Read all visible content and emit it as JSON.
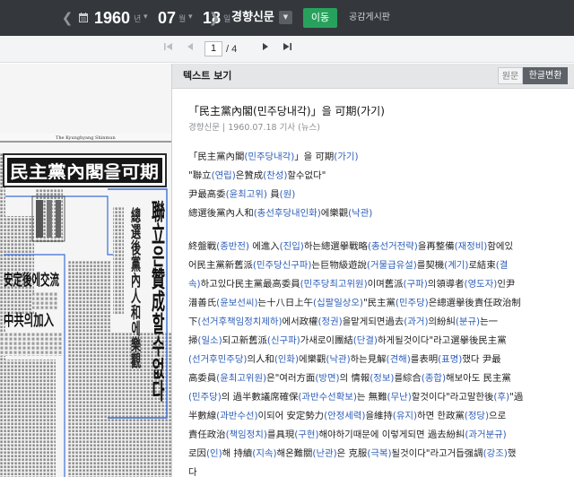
{
  "toolbar": {
    "year": "1960",
    "year_unit": "년",
    "month": "07",
    "month_unit": "월",
    "day": "18",
    "day_unit": "일",
    "newspaper": "경향신문",
    "go_label": "이동",
    "share_label": "공감게시판"
  },
  "pager": {
    "current_page": "1",
    "total": "/ 4"
  },
  "scan": {
    "masthead": "The Kyunghyang Shinmun",
    "headline_box": "民主黨內閣을可期",
    "headline_vertical_1": "聯立은贊成할수없다",
    "headline_vertical_2": "總選後黨內人和에樂觀",
    "left_headline_1": "安定後에交流",
    "left_headline_2": "中共의加入"
  },
  "panel": {
    "title": "텍스트 보기",
    "tab_original": "원문",
    "tab_converted": "한글변환"
  },
  "article": {
    "title": [
      {
        "t": "「民主黨內閣"
      },
      {
        "t": "(민주당내각)",
        "h": true
      },
      {
        "t": "」을 可期"
      },
      {
        "t": "(가기)",
        "h": true
      }
    ],
    "meta": "경향신문 | 1960.07.18 기사 (뉴스)",
    "heading_lines": [
      [
        {
          "t": "「民主黨內閣"
        },
        {
          "t": "(민주당내각)",
          "h": true
        },
        {
          "t": "」을 可期"
        },
        {
          "t": "(가기)",
          "h": true
        }
      ],
      [
        {
          "t": "\"聯立"
        },
        {
          "t": "(연립)",
          "h": true
        },
        {
          "t": "은贊成"
        },
        {
          "t": "(찬성)",
          "h": true
        },
        {
          "t": "할수없다\""
        }
      ],
      [
        {
          "t": "尹最高委"
        },
        {
          "t": "(윤최고위)",
          "h": true
        },
        {
          "t": " 員"
        },
        {
          "t": "(원)",
          "h": true
        }
      ],
      [
        {
          "t": "總選後黨內人和"
        },
        {
          "t": "(총선후당내인화)",
          "h": true
        },
        {
          "t": "에樂觀"
        },
        {
          "t": "(낙관)",
          "h": true
        }
      ]
    ],
    "body_lines": [
      [
        {
          "t": " 終盤戰"
        },
        {
          "t": "(종반전)",
          "h": true
        },
        {
          "t": " 에進入"
        },
        {
          "t": "(진입)",
          "h": true
        },
        {
          "t": "하는總選擧戰略"
        },
        {
          "t": "(총선거전략)",
          "h": true
        },
        {
          "t": "을再整備"
        },
        {
          "t": "(재정비)",
          "h": true
        },
        {
          "t": "함에있"
        }
      ],
      [
        {
          "t": "어民主黨新舊派"
        },
        {
          "t": "(민주당신구파)",
          "h": true
        },
        {
          "t": "는巨物級遊說"
        },
        {
          "t": "(거물급유설)",
          "h": true
        },
        {
          "t": "를契機"
        },
        {
          "t": "(계기)",
          "h": true
        },
        {
          "t": "로結束"
        },
        {
          "t": "(결",
          "h": true
        }
      ],
      [
        {
          "t": "속)",
          "h": true
        },
        {
          "t": "하고있다民主黨最高委員"
        },
        {
          "t": "(민주당최고위원)",
          "h": true
        },
        {
          "t": "이며舊派"
        },
        {
          "t": "(구파)",
          "h": true
        },
        {
          "t": "의領導者"
        },
        {
          "t": "(영도자)",
          "h": true
        },
        {
          "t": "인尹"
        }
      ],
      [
        {
          "t": "潽善氏"
        },
        {
          "t": "(윤보선씨)",
          "h": true
        },
        {
          "t": "는十八日上午"
        },
        {
          "t": "(십팔일상오)",
          "h": true
        },
        {
          "t": "\"民主黨"
        },
        {
          "t": "(민주당)",
          "h": true
        },
        {
          "t": "은總選擧後責任政治制"
        }
      ],
      [
        {
          "t": "下"
        },
        {
          "t": "(선거후책임정치제하)",
          "h": true
        },
        {
          "t": "에서政權"
        },
        {
          "t": "(정권)",
          "h": true
        },
        {
          "t": "을맡게되면過去"
        },
        {
          "t": "(과거)",
          "h": true
        },
        {
          "t": "의紛糾"
        },
        {
          "t": "(분규)",
          "h": true
        },
        {
          "t": "는一"
        }
      ],
      [
        {
          "t": "掃"
        },
        {
          "t": "(일소)",
          "h": true
        },
        {
          "t": "되고新舊派"
        },
        {
          "t": "(신구파)",
          "h": true
        },
        {
          "t": "가새로이團結"
        },
        {
          "t": "(단결)",
          "h": true
        },
        {
          "t": "하게될것이다\"라고選擧後民主黨"
        }
      ],
      [
        {
          "t": "(선거후민주당)",
          "h": true
        },
        {
          "t": "의人和"
        },
        {
          "t": "(인화)",
          "h": true
        },
        {
          "t": "에樂觀"
        },
        {
          "t": "(낙관)",
          "h": true
        },
        {
          "t": "하는見解"
        },
        {
          "t": "(견해)",
          "h": true
        },
        {
          "t": "를表明"
        },
        {
          "t": "(표명)",
          "h": true
        },
        {
          "t": "했다 尹最"
        }
      ],
      [
        {
          "t": "高委員"
        },
        {
          "t": "(윤최고위원)",
          "h": true
        },
        {
          "t": "은\"여러方面"
        },
        {
          "t": "(방면)",
          "h": true
        },
        {
          "t": "의 情報"
        },
        {
          "t": "(정보)",
          "h": true
        },
        {
          "t": "를綜合"
        },
        {
          "t": "(종합)",
          "h": true
        },
        {
          "t": "해보아도 民主黨"
        }
      ],
      [
        {
          "t": "(민주당)",
          "h": true
        },
        {
          "t": "의 過半數議席確保"
        },
        {
          "t": "(과반수선확보)",
          "h": true
        },
        {
          "t": "는 無難"
        },
        {
          "t": "(무난)",
          "h": true
        },
        {
          "t": "할것이다\"라고말한後"
        },
        {
          "t": "(후)",
          "h": true
        },
        {
          "t": "\"過"
        }
      ],
      [
        {
          "t": "半數線"
        },
        {
          "t": "(과반수선)",
          "h": true
        },
        {
          "t": "이되어 安定勢力"
        },
        {
          "t": "(안정세력)",
          "h": true
        },
        {
          "t": "을維持"
        },
        {
          "t": "(유지)",
          "h": true
        },
        {
          "t": "하면 한政黨"
        },
        {
          "t": "(정당)",
          "h": true
        },
        {
          "t": "으로"
        }
      ],
      [
        {
          "t": "責任政治"
        },
        {
          "t": "(책임정치)",
          "h": true
        },
        {
          "t": "를具現"
        },
        {
          "t": "(구현)",
          "h": true
        },
        {
          "t": "해야하기때문에 이렇게되면 過去紛糾"
        },
        {
          "t": "(과거분규)",
          "h": true
        }
      ],
      [
        {
          "t": "로因"
        },
        {
          "t": "(인)",
          "h": true
        },
        {
          "t": "해 持續"
        },
        {
          "t": "(지속)",
          "h": true
        },
        {
          "t": "해온難關"
        },
        {
          "t": "(난관)",
          "h": true
        },
        {
          "t": "은 克服"
        },
        {
          "t": "(극복)",
          "h": true
        },
        {
          "t": "될것이다\"라고거듭强調"
        },
        {
          "t": "(강조)",
          "h": true
        },
        {
          "t": "했"
        }
      ],
      [
        {
          "t": "다"
        }
      ]
    ]
  }
}
